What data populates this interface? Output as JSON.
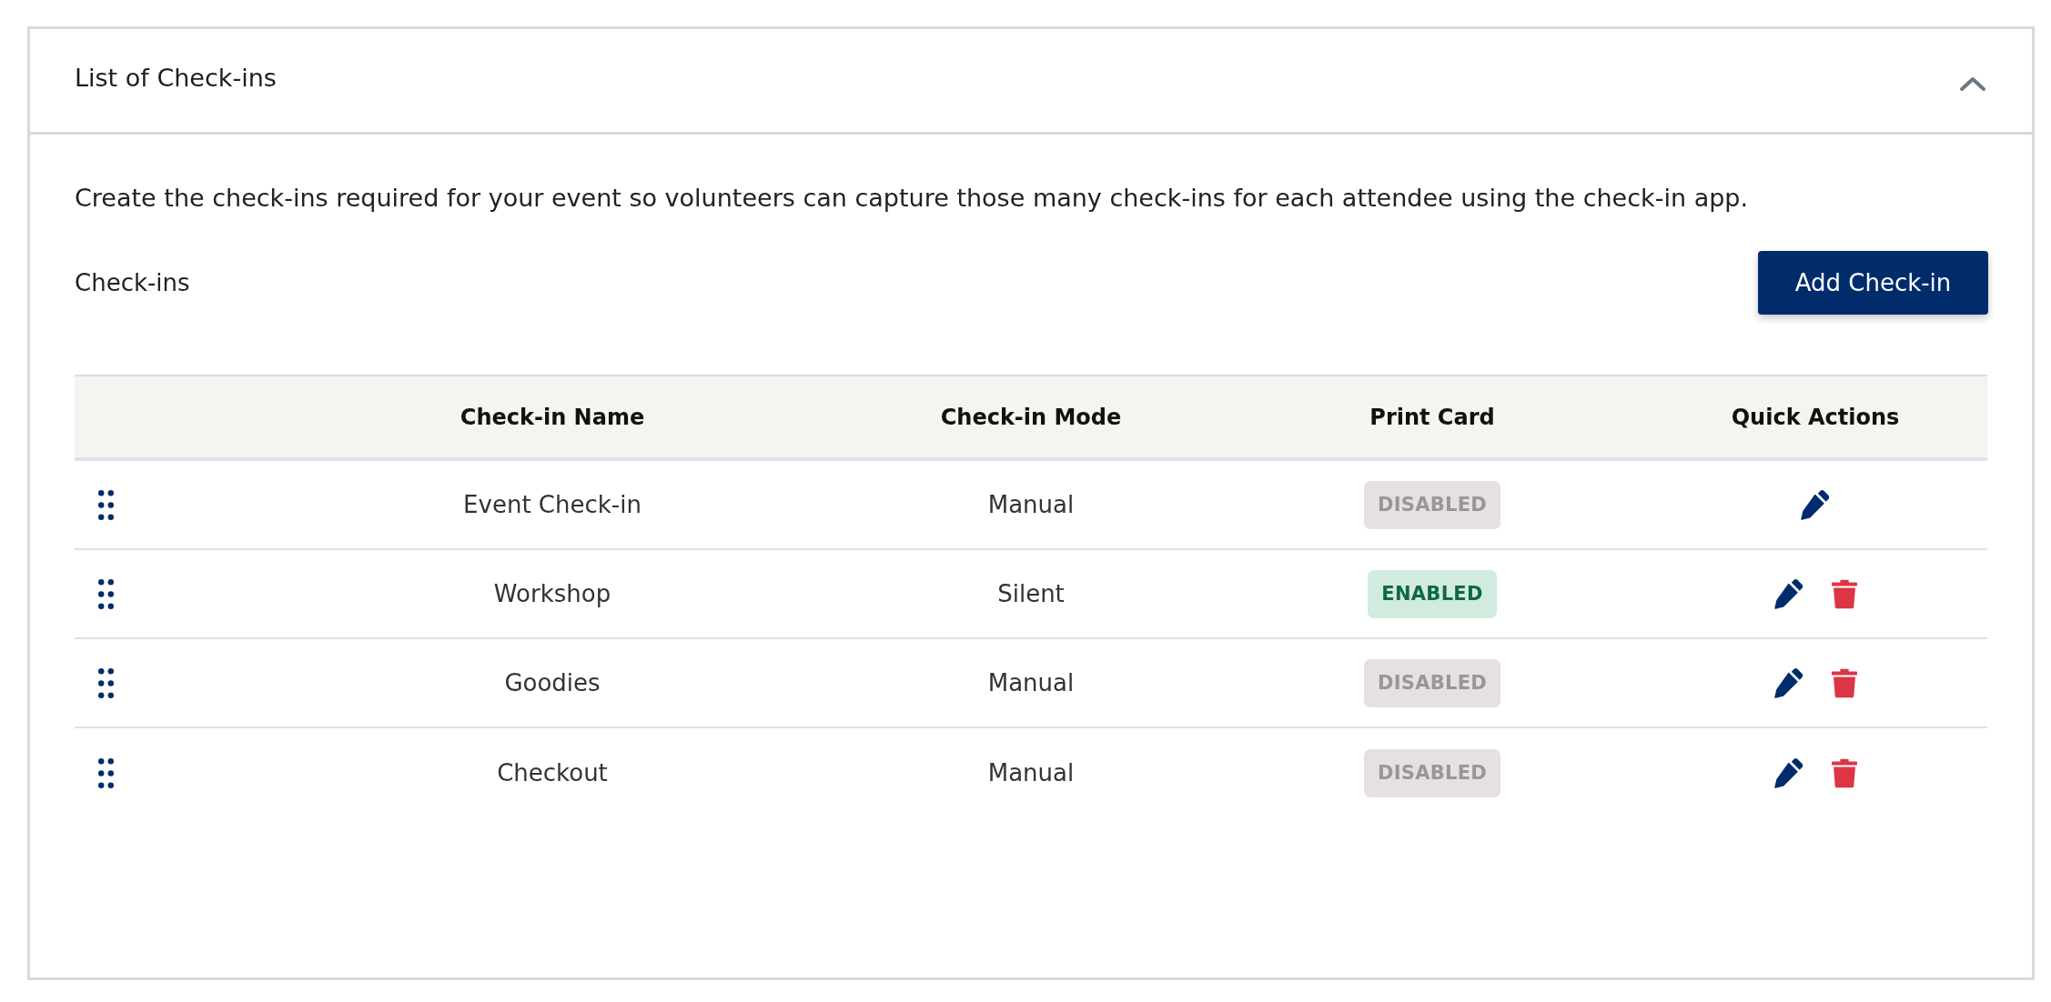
{
  "panel": {
    "title": "List of Check-ins",
    "expanded": true,
    "description": "Create the check-ins required for your event so volunteers can capture those many check-ins for each attendee using the check-in app.",
    "section_label": "Check-ins",
    "add_button": "Add Check-in",
    "table": {
      "columns": [
        "Check-in Name",
        "Check-in Mode",
        "Print Card",
        "Quick Actions"
      ],
      "rows": [
        {
          "name": "Event Check-in",
          "mode": "Manual",
          "print_card": "DISABLED",
          "print_card_enabled": false,
          "deletable": false
        },
        {
          "name": "Workshop",
          "mode": "Silent",
          "print_card": "ENABLED",
          "print_card_enabled": true,
          "deletable": true
        },
        {
          "name": "Goodies",
          "mode": "Manual",
          "print_card": "DISABLED",
          "print_card_enabled": false,
          "deletable": true
        },
        {
          "name": "Checkout",
          "mode": "Manual",
          "print_card": "DISABLED",
          "print_card_enabled": false,
          "deletable": true
        }
      ]
    }
  }
}
